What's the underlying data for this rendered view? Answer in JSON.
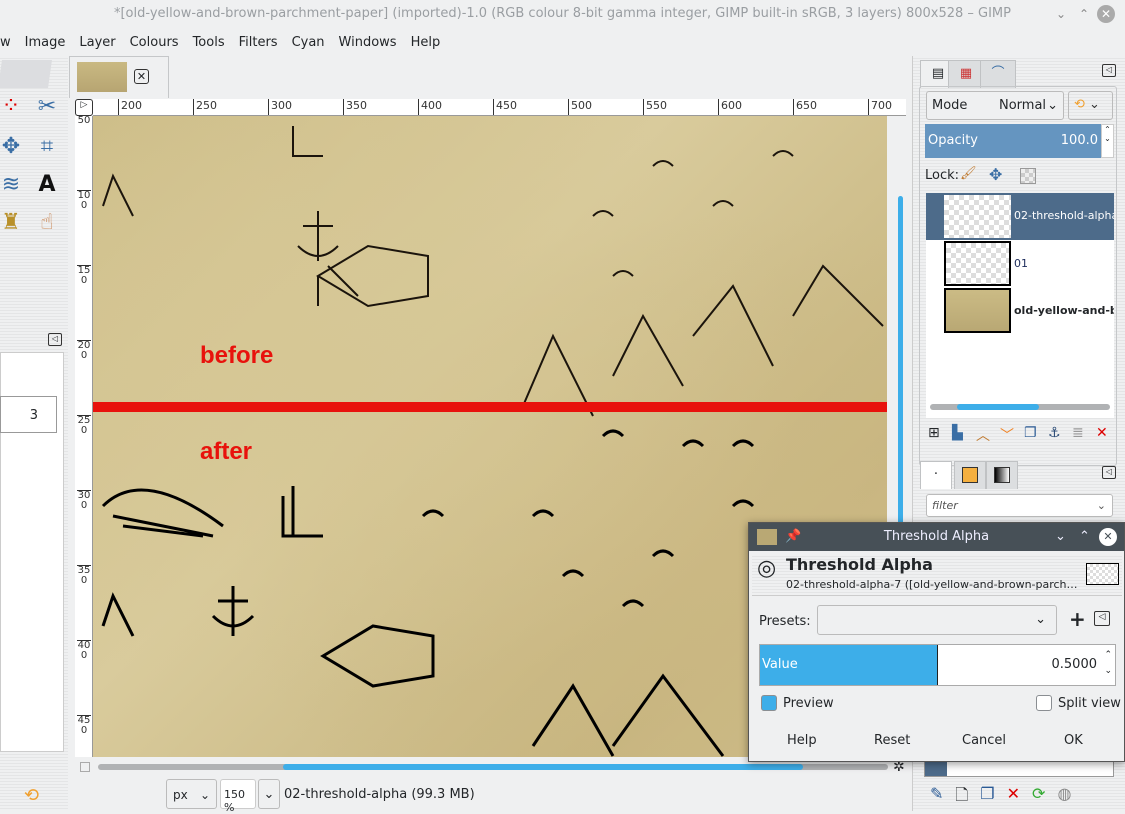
{
  "window": {
    "title": "*[old-yellow-and-brown-parchment-paper] (imported)-1.0 (RGB colour 8-bit gamma integer, GIMP built-in sRGB, 3 layers) 800x528 – GIMP"
  },
  "menu": [
    "w",
    "Image",
    "Layer",
    "Colours",
    "Tools",
    "Filters",
    "Cyan",
    "Windows",
    "Help"
  ],
  "ruler": {
    "h": [
      "200",
      "250",
      "300",
      "350",
      "400",
      "450",
      "500",
      "550",
      "600",
      "650",
      "700"
    ],
    "v": [
      "50",
      "100",
      "150",
      "200",
      "250",
      "300",
      "350",
      "400",
      "450"
    ]
  },
  "canvas": {
    "before": "before",
    "after": "after"
  },
  "left_panel": {
    "spin_value": "3"
  },
  "status": {
    "unit": "px",
    "zoom": "150 %",
    "info": "02-threshold-alpha (99.3 MB)"
  },
  "layers": {
    "mode_label": "Mode",
    "mode_value": "Normal",
    "opacity_label": "Opacity",
    "opacity_value": "100.0",
    "lock_label": "Lock:",
    "items": [
      {
        "name": "02-threshold-alpha",
        "selected": true
      },
      {
        "name": "01",
        "selected": false
      },
      {
        "name": "old-yellow-and-brown-parchment-paper",
        "selected": false
      }
    ]
  },
  "brushes": {
    "filter_placeholder": "filter"
  },
  "dialog": {
    "title": "Threshold Alpha",
    "heading": "Threshold Alpha",
    "subtitle": "02-threshold-alpha-7 ([old-yellow-and-brown-parch…",
    "presets_label": "Presets:",
    "value_label": "Value",
    "value": "0.5000",
    "value_fraction": 0.5,
    "preview_label": "Preview",
    "preview_checked": true,
    "split_label": "Split view",
    "split_checked": false,
    "buttons": {
      "help": "Help",
      "reset": "Reset",
      "cancel": "Cancel",
      "ok": "OK"
    }
  },
  "colors": {
    "accent": "#3daee9",
    "selected_row": "#4d6b8a",
    "red_line": "#e8120c"
  }
}
